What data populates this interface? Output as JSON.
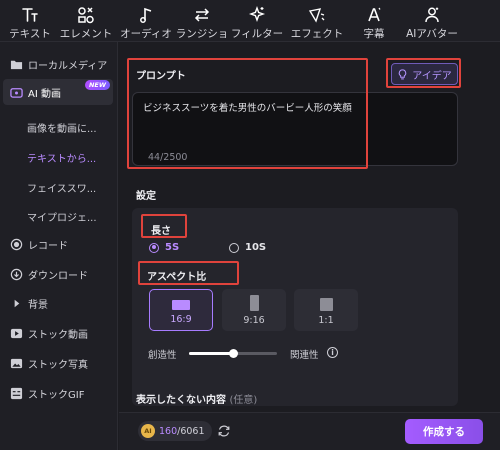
{
  "toolbar": [
    {
      "label": "テキスト",
      "icon": "text-icon"
    },
    {
      "label": "エレメント",
      "icon": "elements-icon"
    },
    {
      "label": "オーディオ",
      "icon": "music-note-icon"
    },
    {
      "label": "トランジション",
      "icon": "transition-arrows-icon"
    },
    {
      "label": "フィルター",
      "icon": "sparkle-icon"
    },
    {
      "label": "エフェクト",
      "icon": "effect-icon"
    },
    {
      "label": "字幕",
      "icon": "subtitle-icon"
    },
    {
      "label": "AIアバター",
      "icon": "avatar-icon"
    }
  ],
  "sidebar": {
    "local_media": "ローカルメディア",
    "ai_video": "AI 動画",
    "new_badge": "NEW",
    "sub_items": [
      "画像を動画に...",
      "テキストから...",
      "フェイススワ...",
      "マイプロジェ..."
    ],
    "active_sub_index": 1,
    "record": "レコード",
    "download": "ダウンロード",
    "background": "背景",
    "stock_video": "ストック動画",
    "stock_photo": "ストック写真",
    "stock_gif": "ストックGIF"
  },
  "prompt": {
    "heading": "プロンプト",
    "idea_button": "アイデア",
    "text": "ビジネススーツを着た男性のバービー人形の笑顔",
    "count": "44/2500"
  },
  "settings": {
    "heading": "設定",
    "length_label": "長さ",
    "length_options": [
      "5S",
      "10S"
    ],
    "length_selected": "5S",
    "aspect_label": "アスペクト比",
    "aspect_options": [
      "16:9",
      "9:16",
      "1:1"
    ],
    "aspect_selected": "16:9",
    "creativity_label": "創造性",
    "relevance_label": "関連性",
    "slider_value": 0.5
  },
  "negative": {
    "label": "表示したくない内容",
    "optional": "(任意)"
  },
  "footer": {
    "credits_used": "160",
    "credits_total": "/6061",
    "create_button": "作成する"
  },
  "colors": {
    "accent": "#b98bff",
    "highlight": "#e0433c",
    "panel": "#25252c"
  }
}
